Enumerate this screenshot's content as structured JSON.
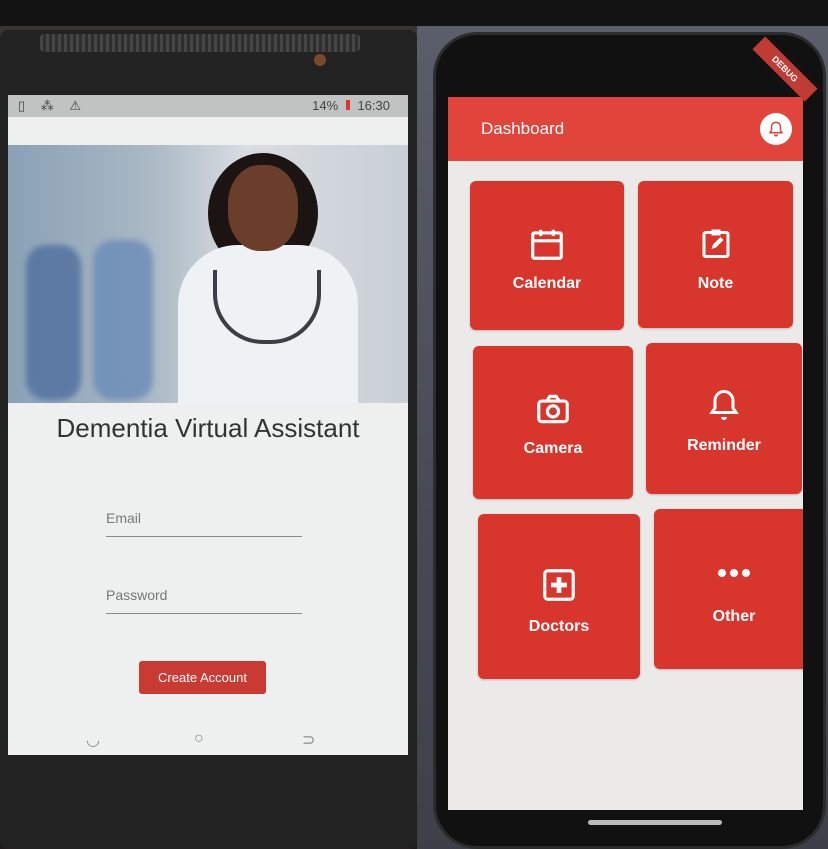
{
  "left_screen": {
    "status": {
      "icons": "▯ ⁂ ⚠",
      "battery": "14%",
      "time": "16:30"
    },
    "title": "Dementia Virtual Assistant",
    "email_placeholder": "Email",
    "password_placeholder": "Password",
    "create_button": "Create Account",
    "nav": {
      "back": "◡",
      "home": "○",
      "recent": "⊃"
    }
  },
  "right_screen": {
    "debug_banner": "DEBUG",
    "appbar_title": "Dashboard",
    "tiles": [
      {
        "label": "Calendar",
        "icon": "calendar-icon"
      },
      {
        "label": "Note",
        "icon": "note-icon"
      },
      {
        "label": "Camera",
        "icon": "camera-icon"
      },
      {
        "label": "Reminder",
        "icon": "bell-icon"
      },
      {
        "label": "Doctors",
        "icon": "medical-cross-icon"
      },
      {
        "label": "Other",
        "icon": "more-dots-icon"
      }
    ],
    "colors": {
      "primary": "#e0443b",
      "tile": "#d8352d",
      "background": "#eceae9"
    }
  }
}
